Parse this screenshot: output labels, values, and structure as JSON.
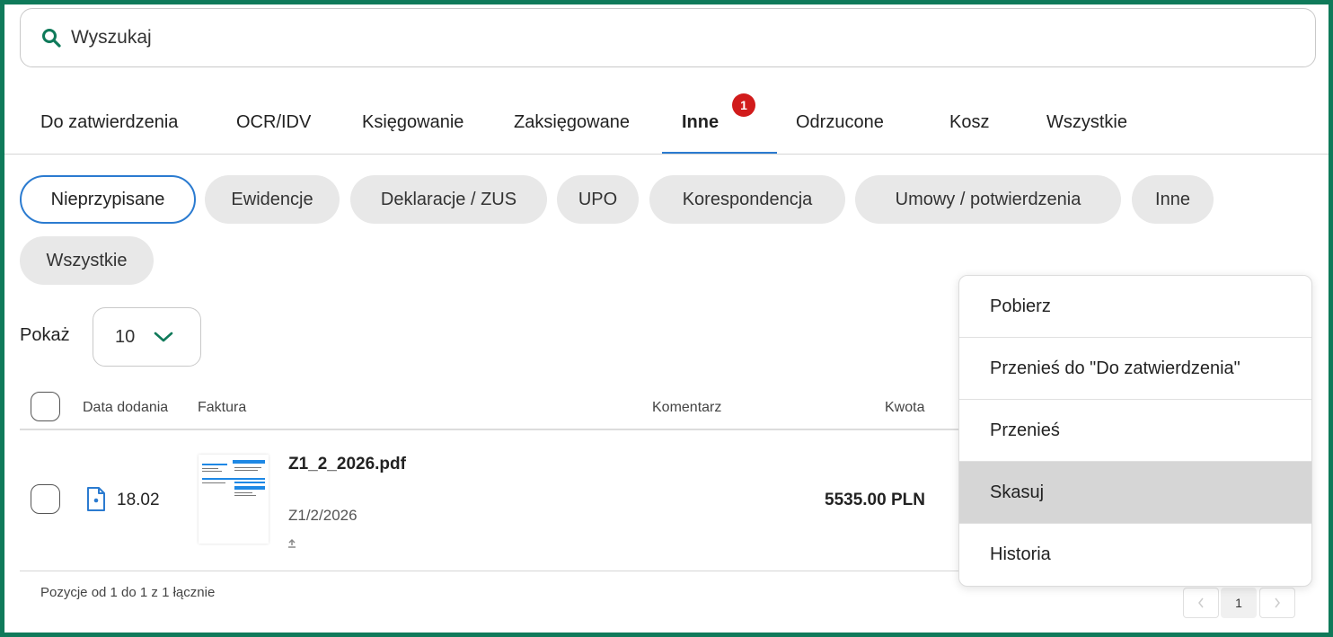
{
  "search": {
    "placeholder": "Wyszukaj"
  },
  "tabs": [
    {
      "label": "Do zatwierdzenia"
    },
    {
      "label": "OCR/IDV"
    },
    {
      "label": "Księgowanie"
    },
    {
      "label": "Zaksięgowane"
    },
    {
      "label": "Inne",
      "active": true,
      "badge": "1"
    },
    {
      "label": "Odrzucone"
    },
    {
      "label": "Kosz"
    },
    {
      "label": "Wszystkie"
    }
  ],
  "chips": [
    {
      "label": "Nieprzypisane",
      "active": true
    },
    {
      "label": "Ewidencje"
    },
    {
      "label": "Deklaracje / ZUS"
    },
    {
      "label": "UPO"
    },
    {
      "label": "Korespondencja"
    },
    {
      "label": "Umowy / potwierdzenia"
    },
    {
      "label": "Inne"
    },
    {
      "label": "Wszystkie"
    }
  ],
  "page_size": {
    "label": "Pokaż",
    "value": "10"
  },
  "table": {
    "headers": {
      "date": "Data dodania",
      "invoice": "Faktura",
      "comment": "Komentarz",
      "amount": "Kwota"
    },
    "rows": [
      {
        "date": "18.02",
        "file_name": "Z1_2_2026.pdf",
        "doc_number": "Z1/2/2026",
        "amount": "5535.00 PLN"
      }
    ]
  },
  "footer": {
    "summary": "Pozycje od 1 do 1 z 1 łącznie",
    "current_page": "1"
  },
  "context_menu": {
    "items": [
      {
        "label": "Pobierz"
      },
      {
        "label": "Przenieś do \"Do zatwierdzenia\""
      },
      {
        "label": "Przenieś"
      },
      {
        "label": "Skasuj",
        "highlighted": true
      },
      {
        "label": "Historia"
      }
    ]
  },
  "colors": {
    "frame": "#0f7a5a",
    "accent": "#2b7bd0",
    "badge": "#d11b1b",
    "search_icon": "#0f7a5a"
  }
}
